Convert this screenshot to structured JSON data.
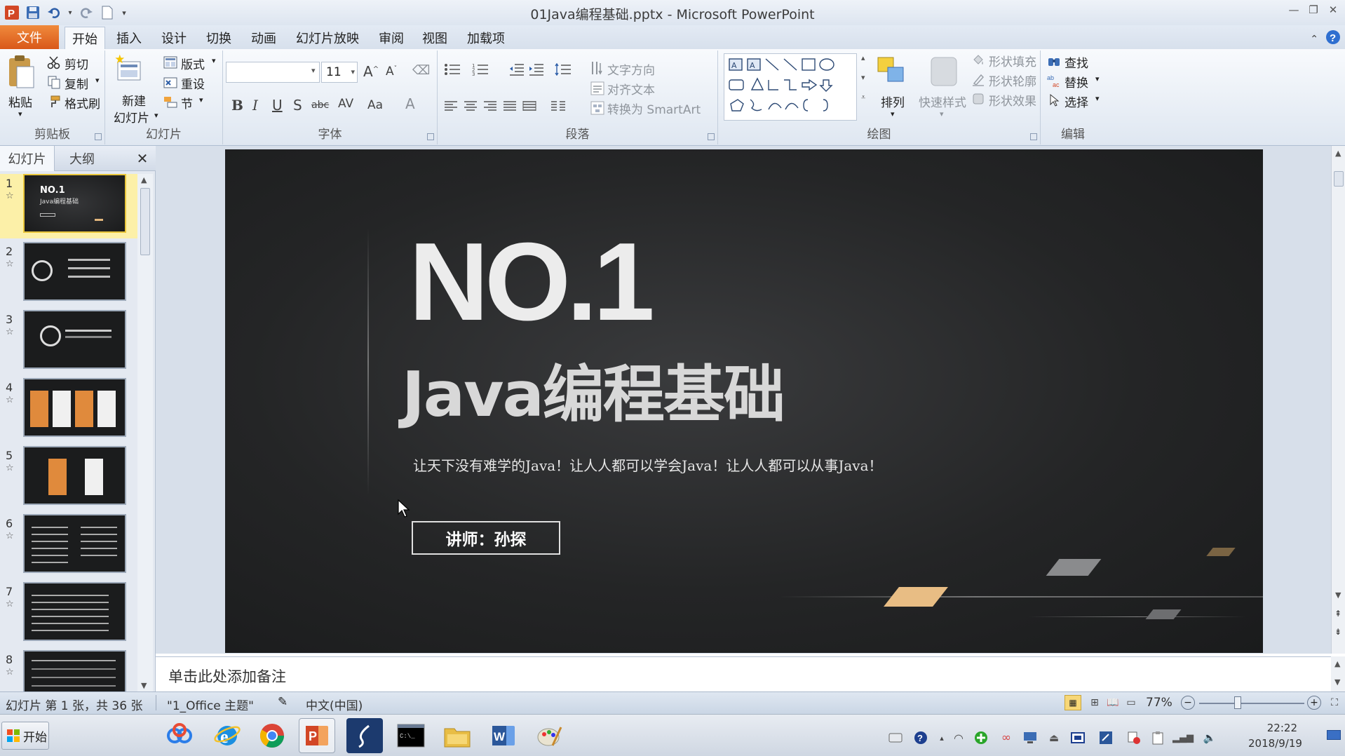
{
  "titlebar": {
    "title": "01Java编程基础.pptx - Microsoft PowerPoint"
  },
  "tabs": {
    "file": "文件",
    "items": [
      "开始",
      "插入",
      "设计",
      "切换",
      "动画",
      "幻灯片放映",
      "审阅",
      "视图",
      "加载项"
    ]
  },
  "ribbon": {
    "clipboard": {
      "label": "剪贴板",
      "paste": "粘贴",
      "cut": "剪切",
      "copy": "复制",
      "format_painter": "格式刷"
    },
    "slides": {
      "label": "幻灯片",
      "new_slide_line1": "新建",
      "new_slide_line2": "幻灯片",
      "layout": "版式",
      "reset": "重设",
      "section": "节"
    },
    "font": {
      "label": "字体",
      "size": "11"
    },
    "paragraph": {
      "label": "段落",
      "text_direction": "文字方向",
      "align_text": "对齐文本",
      "convert_smartart": "转换为 SmartArt"
    },
    "drawing": {
      "label": "绘图",
      "arrange": "排列",
      "quick_styles": "快速样式",
      "shape_fill": "形状填充",
      "shape_outline": "形状轮廓",
      "shape_effects": "形状效果"
    },
    "editing": {
      "label": "编辑",
      "find": "查找",
      "replace": "替换",
      "select": "选择"
    }
  },
  "panel": {
    "tab_slides": "幻灯片",
    "tab_outline": "大纲",
    "thumbs": [
      "1",
      "2",
      "3",
      "4",
      "5",
      "6",
      "7",
      "8"
    ],
    "thumb1_title": "NO.1",
    "thumb1_sub": "Java编程基础"
  },
  "slide": {
    "heading": "NO.1",
    "title": "Java编程基础",
    "subtitle": "让天下没有难学的Java！让人人都可以学会Java！让人人都可以从事Java！",
    "lecturer": "讲师：孙探"
  },
  "notes": {
    "placeholder": "单击此处添加备注"
  },
  "status": {
    "slide_info": "幻灯片 第 1 张，共 36 张",
    "theme": "\"1_Office 主题\"",
    "language": "中文(中国)",
    "zoom": "77%"
  },
  "taskbar": {
    "start": "开始",
    "time": "22:22",
    "date": "2018/9/19"
  }
}
